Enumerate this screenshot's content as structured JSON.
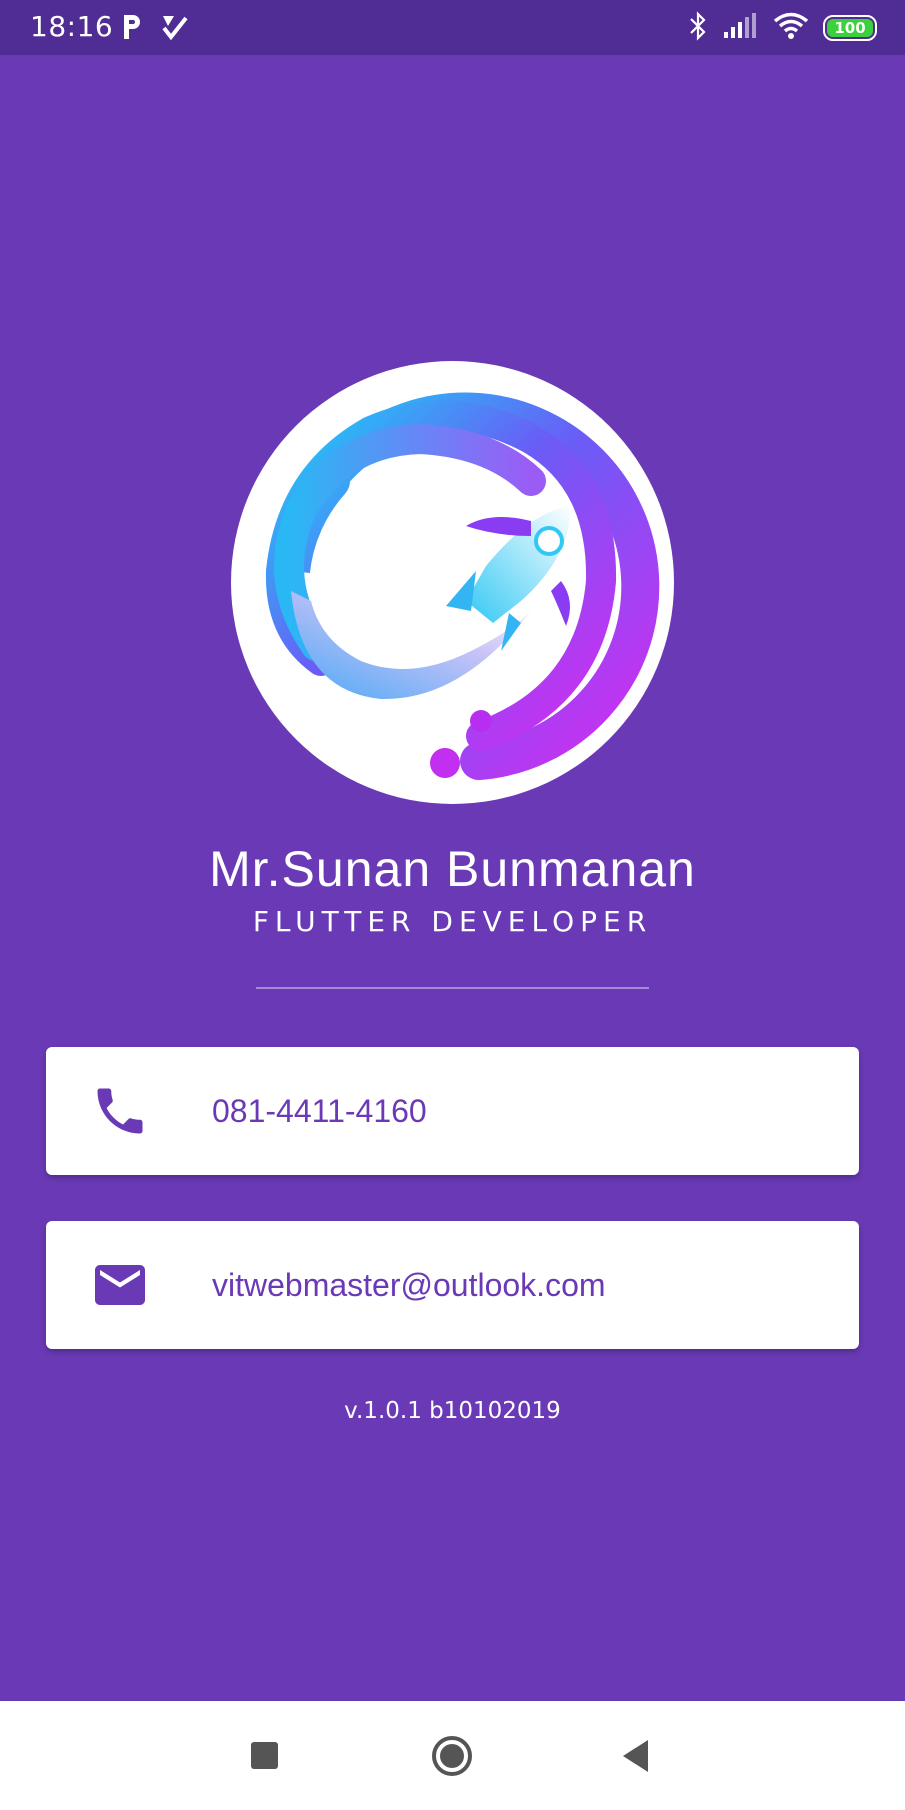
{
  "status_bar": {
    "time": "18:16",
    "battery": "100",
    "icons": [
      "parking-app-icon",
      "checkmark-app-icon",
      "bluetooth-icon",
      "cell-signal-icon",
      "wifi-icon",
      "battery-icon"
    ]
  },
  "profile": {
    "name": "Mr.Sunan Bunmanan",
    "title": "FLUTTER DEVELOPER",
    "avatar_icon": "rocket-logo-icon"
  },
  "contacts": {
    "phone": {
      "icon": "phone-icon",
      "value": "081-4411-4160"
    },
    "email": {
      "icon": "mail-icon",
      "value": "vitwebmaster@outlook.com"
    }
  },
  "version": "v.1.0.1 b10102019",
  "navigation": {
    "buttons": [
      "recents-button",
      "home-button",
      "back-button"
    ]
  },
  "colors": {
    "background": "#6a3ab6",
    "status_bar": "#4f2d94",
    "card": "#ffffff",
    "accent_text": "#6a3ab6",
    "battery": "#3bd13b"
  }
}
